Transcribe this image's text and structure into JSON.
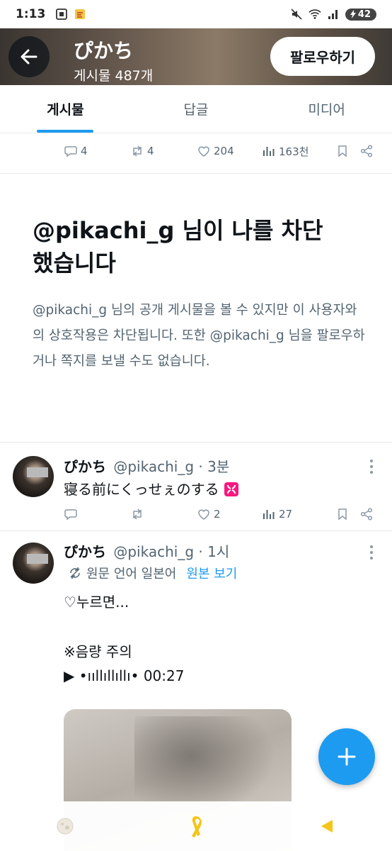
{
  "status_bar": {
    "time": "1:13",
    "battery": "42",
    "icons": [
      "screenshot-icon",
      "notes-icon",
      "mute-icon",
      "wifi-icon",
      "signal-icon",
      "battery-icon"
    ]
  },
  "header": {
    "display_name": "ぴかち",
    "post_count": "게시물 487개",
    "follow_label": "팔로우하기"
  },
  "tabs": [
    {
      "label": "게시물",
      "active": true
    },
    {
      "label": "답글",
      "active": false
    },
    {
      "label": "미디어",
      "active": false
    }
  ],
  "top_actions": {
    "replies": "4",
    "reposts": "4",
    "likes": "204",
    "views": "163천"
  },
  "blocked": {
    "title": "@pikachi_g 님이 나를 차단했습니다",
    "description": "@pikachi_g 님의 공개 게시물을 볼 수 있지만 이 사용자와의 상호작용은 차단됩니다. 또한 @pikachi_g 님을 팔로우하거나 쪽지를 보낼 수도 없습니다."
  },
  "posts": [
    {
      "name": "ぴかち",
      "handle": "@pikachi_g",
      "time": "· 3분",
      "text": "寝る前にくっせぇのする",
      "actions": {
        "replies": "",
        "reposts": "",
        "likes": "2",
        "views": "27"
      }
    },
    {
      "name": "ぴかち",
      "handle": "@pikachi_g",
      "time": "· 1시",
      "translate_note": "원문 언어 일본어",
      "translate_link": "원본 보기",
      "lines": [
        "♡누르면...",
        "※음량 주의",
        "▶ •ııllıllıllı• 00:27"
      ]
    }
  ],
  "colors": {
    "accent": "#1d9bf0",
    "text": "#0f1419",
    "muted": "#536471"
  }
}
